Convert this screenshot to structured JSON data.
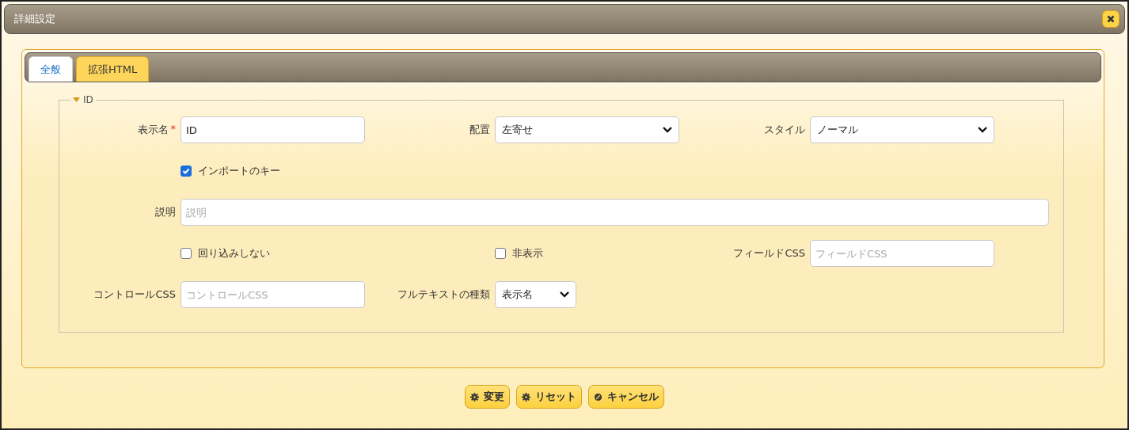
{
  "dialog": {
    "title": "詳細設定"
  },
  "tabs": [
    {
      "label": "全般",
      "selected": true
    },
    {
      "label": "拡張HTML",
      "selected": false
    }
  ],
  "section": {
    "title": "ID",
    "expanded": true
  },
  "rows": [
    [
      {
        "kind": "text",
        "label": "表示名",
        "required_mark": "*",
        "value": "ID"
      },
      {
        "kind": "select",
        "label": "配置",
        "value": "左寄せ"
      },
      {
        "kind": "select",
        "label": "スタイル",
        "value": "ノーマル"
      }
    ],
    [
      {
        "kind": "checkbox",
        "label": "インポートのキー",
        "checked": true
      }
    ],
    [
      {
        "kind": "wide_text",
        "label": "説明",
        "placeholder": "説明"
      }
    ],
    [
      {
        "kind": "checkbox",
        "label": "回り込みしない",
        "checked": false
      },
      {
        "kind": "checkbox",
        "label": "非表示",
        "checked": false
      },
      {
        "kind": "text",
        "label": "フィールドCSS",
        "placeholder": "フィールドCSS"
      }
    ],
    [
      {
        "kind": "text",
        "label": "コントロールCSS",
        "placeholder": "コントロールCSS"
      },
      {
        "kind": "small_select",
        "label": "フルテキストの種類",
        "value": "表示名"
      }
    ]
  ],
  "buttons": [
    {
      "label": "変更",
      "kind": "gear"
    },
    {
      "label": "リセット",
      "kind": "gear"
    },
    {
      "label": "キャンセル",
      "kind": "cancel"
    }
  ]
}
